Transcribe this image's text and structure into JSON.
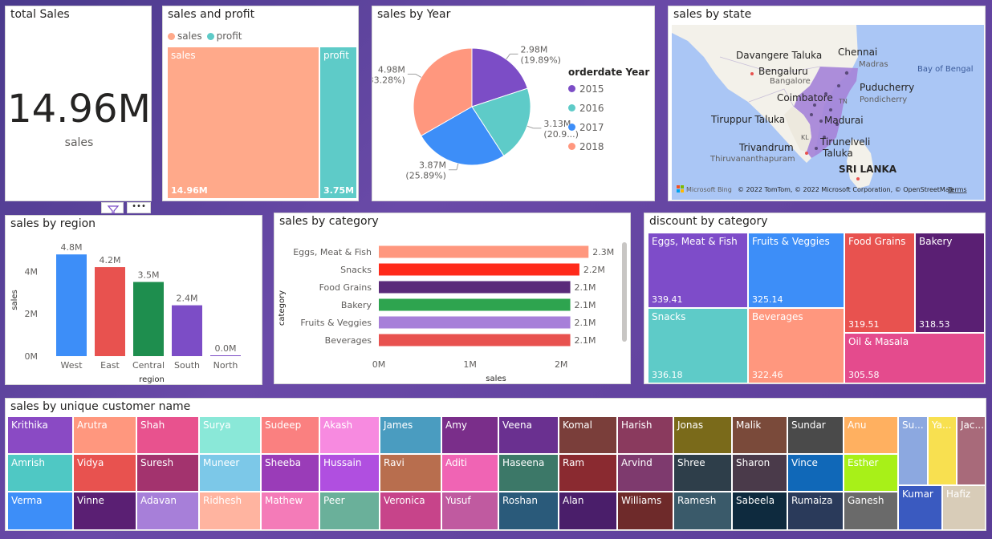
{
  "total_sales": {
    "title": "total Sales",
    "value": "14.96M",
    "label": "sales"
  },
  "sales_profit": {
    "title": "sales and profit",
    "legend": [
      {
        "name": "sales",
        "color": "#FFA98A"
      },
      {
        "name": "profit",
        "color": "#5ECBC8"
      }
    ],
    "cells": [
      {
        "name": "sales",
        "value": "14.96M",
        "share": 0.7996,
        "color": "#FFA98A"
      },
      {
        "name": "profit",
        "value": "3.75M",
        "share": 0.2004,
        "color": "#5ECBC8"
      }
    ]
  },
  "sales_by_year": {
    "title": "sales by Year",
    "legend_title": "orderdate Year",
    "chart_data": {
      "type": "pie",
      "slices": [
        {
          "name": "2015",
          "value": 2.98,
          "label": "2.98M",
          "pct": "(19.89%)",
          "color": "#7C4DC6"
        },
        {
          "name": "2016",
          "value": 3.13,
          "label": "3.13M",
          "pct": "(20.9...)",
          "color": "#5ECBC8"
        },
        {
          "name": "2017",
          "value": 3.87,
          "label": "3.87M",
          "pct": "(25.89%)",
          "color": "#3D8EF8"
        },
        {
          "name": "2018",
          "value": 4.98,
          "label": "4.98M",
          "pct": "(33.28%)",
          "color": "#FF977E"
        }
      ]
    }
  },
  "sales_by_state": {
    "title": "sales by state",
    "places": [
      {
        "name": "Chennai",
        "sub": "Madras"
      },
      {
        "name": "Davangere Taluka",
        "sub": ""
      },
      {
        "name": "Bengaluru",
        "sub": "Bangalore"
      },
      {
        "name": "Puducherry",
        "sub": "Pondicherry"
      },
      {
        "name": "Coimbatore",
        "sub": ""
      },
      {
        "name": "Madurai",
        "sub": ""
      },
      {
        "name": "Tiruppur Taluka",
        "sub": ""
      },
      {
        "name": "Tirunelveli",
        "sub": "Taluka"
      },
      {
        "name": "Trivandrum",
        "sub": "Thiruvananthapuram"
      },
      {
        "name": "SRI LANKA",
        "sub": ""
      }
    ],
    "sea_label": "Bay of Bengal",
    "state_codes": [
      "TN",
      "KL"
    ],
    "bing": "Microsoft Bing",
    "copyright": "© 2022 TomTom, © 2022 Microsoft Corporation, © OpenStreetMap",
    "terms": "Terms",
    "colors": {
      "water": "#AAC6F5",
      "land": "#F3F1EA",
      "tn": "#A684D8"
    }
  },
  "sales_by_region": {
    "title": "sales by region",
    "chart_data": {
      "type": "bar",
      "categories": [
        "West",
        "East",
        "Central",
        "South",
        "North"
      ],
      "values": [
        4.8,
        4.2,
        3.5,
        2.4,
        0.0
      ],
      "labels": [
        "4.8M",
        "4.2M",
        "3.5M",
        "2.4M",
        "0.0M"
      ],
      "colors": [
        "#3D8EF8",
        "#E8524F",
        "#1E8E4E",
        "#7C4DC6",
        "#7C4DC6"
      ],
      "yticks": [
        "0M",
        "2M",
        "4M"
      ],
      "ylim": [
        0,
        5.3
      ],
      "xlabel": "region",
      "ylabel": "sales"
    }
  },
  "sales_by_category": {
    "title": "sales by category",
    "chart_data": {
      "type": "bar",
      "orientation": "horizontal",
      "categories": [
        "Eggs, Meat & Fish",
        "Snacks",
        "Food Grains",
        "Bakery",
        "Fruits & Veggies",
        "Beverages"
      ],
      "values": [
        2.3,
        2.2,
        2.1,
        2.1,
        2.1,
        2.1
      ],
      "labels": [
        "2.3M",
        "2.2M",
        "2.1M",
        "2.1M",
        "2.1M",
        "2.1M"
      ],
      "colors": [
        "#FF977E",
        "#FF2A1A",
        "#5A2A7A",
        "#2EA44F",
        "#A77FD9",
        "#E8524F"
      ],
      "xticks": [
        "0M",
        "1M",
        "2M"
      ],
      "xlim": [
        0,
        2.5
      ],
      "xlabel": "sales",
      "ylabel": "category"
    }
  },
  "discount_by_category": {
    "title": "discount by category",
    "cells": [
      {
        "name": "Eggs, Meat & Fish",
        "value": "339.41",
        "color": "#7E4CC9"
      },
      {
        "name": "Fruits & Veggies",
        "value": "325.14",
        "color": "#3D8EF8"
      },
      {
        "name": "Food Grains",
        "value": "319.51",
        "color": "#E8524F"
      },
      {
        "name": "Bakery",
        "value": "318.53",
        "color": "#5A1F73"
      },
      {
        "name": "Snacks",
        "value": "336.18",
        "color": "#5ECBC8"
      },
      {
        "name": "Beverages",
        "value": "322.46",
        "color": "#FF977E"
      },
      {
        "name": "Oil & Masala",
        "value": "305.58",
        "color": "#E44B8D"
      }
    ]
  },
  "customers": {
    "title": "sales by unique customer name",
    "cells": [
      {
        "name": "Krithika",
        "color": "#8A4AC4"
      },
      {
        "name": "Amrish",
        "color": "#4FC8C4"
      },
      {
        "name": "Verma",
        "color": "#3D8EF8"
      },
      {
        "name": "Arutra",
        "color": "#FF977E"
      },
      {
        "name": "Vidya",
        "color": "#E8524F"
      },
      {
        "name": "Vinne",
        "color": "#5A1F73"
      },
      {
        "name": "Shah",
        "color": "#E8528E"
      },
      {
        "name": "Suresh",
        "color": "#A3336E"
      },
      {
        "name": "Adavan",
        "color": "#A77FD9"
      },
      {
        "name": "Surya",
        "color": "#8AE8D8"
      },
      {
        "name": "Muneer",
        "color": "#7CC8E8"
      },
      {
        "name": "Ridhesh",
        "color": "#FFB4A0"
      },
      {
        "name": "Sudeep",
        "color": "#FA8080"
      },
      {
        "name": "Sheeba",
        "color": "#9A3CB8"
      },
      {
        "name": "Mathew",
        "color": "#F47BB8"
      },
      {
        "name": "Akash",
        "color": "#F78AE0"
      },
      {
        "name": "Hussain",
        "color": "#B04FE0"
      },
      {
        "name": "Peer",
        "color": "#6AB09A"
      },
      {
        "name": "James",
        "color": "#4A9CC0"
      },
      {
        "name": "Ravi",
        "color": "#B86E4E"
      },
      {
        "name": "Veronica",
        "color": "#C7448A"
      },
      {
        "name": "Amy",
        "color": "#7A2E8A"
      },
      {
        "name": "Aditi",
        "color": "#F064B4"
      },
      {
        "name": "Yusuf",
        "color": "#C05AA0"
      },
      {
        "name": "Veena",
        "color": "#6A3090"
      },
      {
        "name": "Haseena",
        "color": "#3C7868"
      },
      {
        "name": "Roshan",
        "color": "#2A5A7A"
      },
      {
        "name": "Komal",
        "color": "#7A3E3A"
      },
      {
        "name": "Ram",
        "color": "#8A2A30"
      },
      {
        "name": "Alan",
        "color": "#4A1E6A"
      },
      {
        "name": "Harish",
        "color": "#8A3A5E"
      },
      {
        "name": "Arvind",
        "color": "#7E3A6E"
      },
      {
        "name": "Williams",
        "color": "#6E2A2A"
      },
      {
        "name": "Jonas",
        "color": "#7A6A1A"
      },
      {
        "name": "Shree",
        "color": "#2E3E4A"
      },
      {
        "name": "Ramesh",
        "color": "#3A5A6A"
      },
      {
        "name": "Malik",
        "color": "#7A4A3A"
      },
      {
        "name": "Sharon",
        "color": "#4A3A4A"
      },
      {
        "name": "Sabeela",
        "color": "#0E2A3E"
      },
      {
        "name": "Sundar",
        "color": "#4A4A4A"
      },
      {
        "name": "Vince",
        "color": "#1068B8"
      },
      {
        "name": "Rumaiza",
        "color": "#2A3A5A"
      },
      {
        "name": "Anu",
        "color": "#FFB060"
      },
      {
        "name": "Esther",
        "color": "#A8F018"
      },
      {
        "name": "Ganesh",
        "color": "#6A6A6A"
      },
      {
        "name": "Su...",
        "color": "#8CA8E0"
      },
      {
        "name": "Ya...",
        "color": "#F8E050"
      },
      {
        "name": "Jac...",
        "color": "#A86A7A"
      },
      {
        "name": "Kumar",
        "color": "#3A5AC0"
      },
      {
        "name": "Hafiz",
        "color": "#D8CCB8"
      }
    ]
  }
}
